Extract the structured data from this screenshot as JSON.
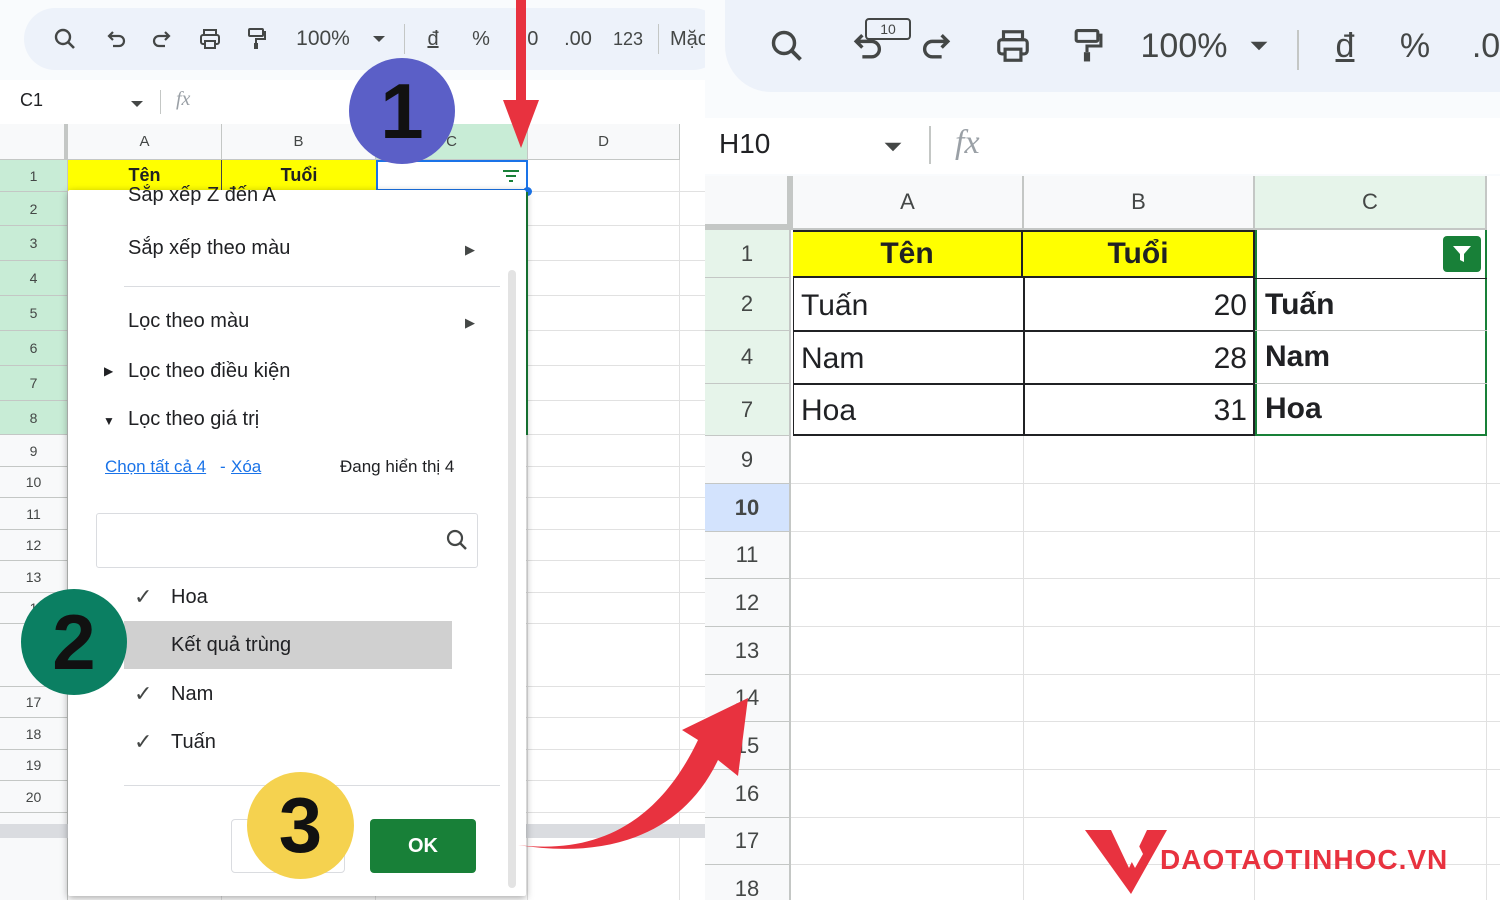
{
  "left": {
    "toolbar": {
      "zoom": "100%",
      "currency": "đ",
      "percent": "%",
      "dec_less": ".0",
      "dec_more": ".00",
      "number_format": "123",
      "font": "Mặc đị"
    },
    "name_box": "C1",
    "fx": "fx",
    "columns": [
      "A",
      "B",
      "C",
      "D"
    ],
    "rows": [
      "1",
      "2",
      "3",
      "4",
      "5",
      "6",
      "7",
      "8",
      "9",
      "10",
      "11",
      "12",
      "13",
      "1",
      "",
      "17",
      "18",
      "19",
      "20"
    ],
    "header_cells": {
      "a1": "Tên",
      "b1": "Tuổi"
    },
    "menu": {
      "sort_za": "Sắp xếp Z đến A",
      "sort_color": "Sắp xếp theo màu",
      "filter_color": "Lọc theo màu",
      "filter_condition": "Lọc theo điều kiện",
      "filter_values": "Lọc theo giá trị",
      "select_all": "Chọn tất cả 4",
      "dash": "-",
      "clear": "Xóa",
      "showing": "Đang hiển thị 4",
      "search_placeholder": "",
      "values": [
        {
          "label": "Hoa",
          "checked": true
        },
        {
          "label": "Kết quả trùng",
          "checked": false
        },
        {
          "label": "Nam",
          "checked": true
        },
        {
          "label": "Tuấn",
          "checked": true
        }
      ],
      "ok": "OK",
      "cancel": ""
    }
  },
  "badges": [
    "1",
    "2",
    "3"
  ],
  "right": {
    "toolbar": {
      "zoom": "100%",
      "currency": "đ",
      "percent": "%",
      "dec": ".0",
      "font_size": "10"
    },
    "name_box": "H10",
    "fx": "fx",
    "columns": [
      "A",
      "B",
      "C"
    ],
    "rows": [
      "1",
      "2",
      "4",
      "7",
      "9",
      "10",
      "11",
      "12",
      "13",
      "14",
      "15",
      "16",
      "17",
      "18"
    ],
    "cells": {
      "a1": "Tên",
      "b1": "Tuổi",
      "a2": "Tuấn",
      "b2": "20",
      "c2": "Tuấn",
      "a4": "Nam",
      "b4": "28",
      "c4": "Nam",
      "a7": "Hoa",
      "b7": "31",
      "c7": "Hoa"
    }
  },
  "logo": {
    "text": "DAOTAOTINHOC.VN"
  },
  "colors": {
    "yellow": "#ffff00",
    "green_ok": "#188038",
    "red_arrow": "#e8323f",
    "badge1": "#5b5fc7",
    "badge2": "#0b7f62",
    "badge3": "#f5d24f"
  }
}
